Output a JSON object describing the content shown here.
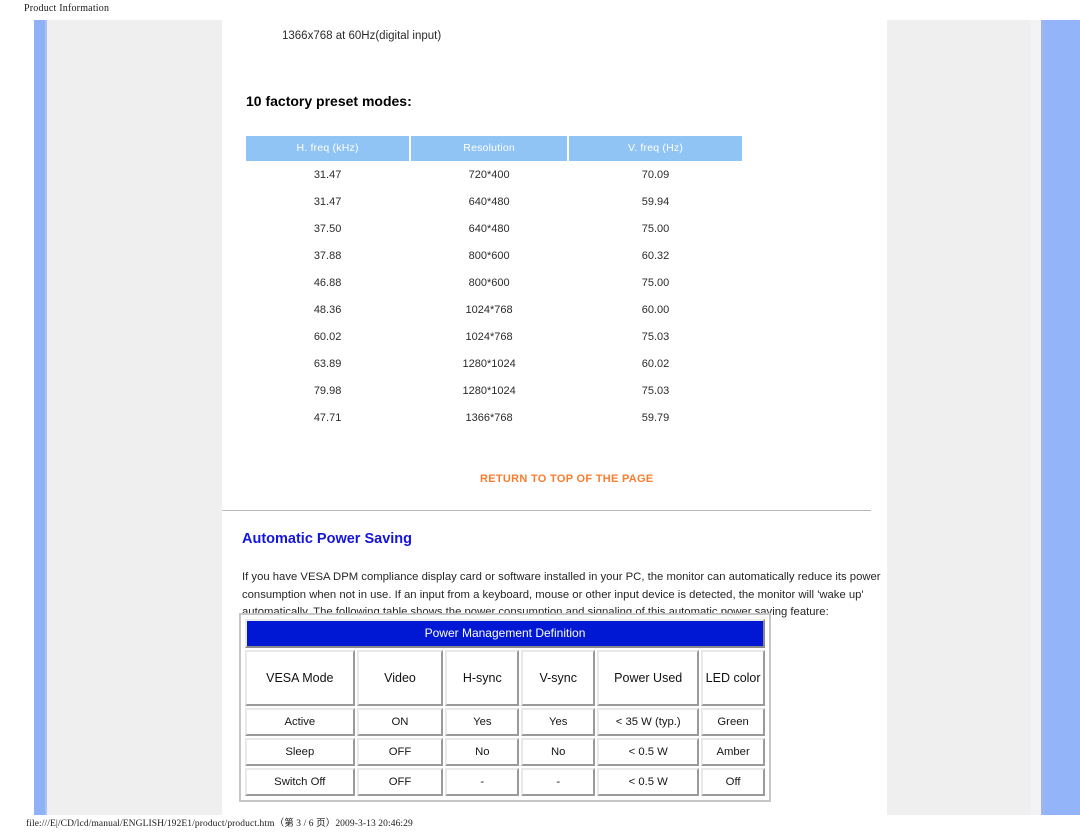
{
  "print": {
    "header_title": "Product Information",
    "footer_text": "file:///E|/CD/lcd/manual/ENGLISH/192E1/product/product.htm（第 3 / 6 页）2009-3-13 20:46:29"
  },
  "page": {
    "resolution_note": "1366x768 at 60Hz(digital input)",
    "preset_section_title": "10 factory preset modes:",
    "return_link": "RETURN TO TOP OF THE PAGE",
    "power_heading": "Automatic Power Saving",
    "power_paragraph": "If you have VESA DPM compliance display card or software installed in your PC, the monitor can automatically reduce its power consumption when not in use. If an input from a keyboard, mouse or other input device is detected, the monitor will 'wake up' automatically. The following table shows the power consumption and signaling of this automatic power saving feature:"
  },
  "preset_table": {
    "headers": [
      "H. freq (kHz)",
      "Resolution",
      "V. freq (Hz)"
    ],
    "rows": [
      [
        "31.47",
        "720*400",
        "70.09"
      ],
      [
        "31.47",
        "640*480",
        "59.94"
      ],
      [
        "37.50",
        "640*480",
        "75.00"
      ],
      [
        "37.88",
        "800*600",
        "60.32"
      ],
      [
        "46.88",
        "800*600",
        "75.00"
      ],
      [
        "48.36",
        "1024*768",
        "60.00"
      ],
      [
        "60.02",
        "1024*768",
        "75.03"
      ],
      [
        "63.89",
        "1280*1024",
        "60.02"
      ],
      [
        "79.98",
        "1280*1024",
        "75.03"
      ],
      [
        "47.71",
        "1366*768",
        "59.79"
      ]
    ]
  },
  "power_table": {
    "title": "Power Management Definition",
    "headers": [
      "VESA Mode",
      "Video",
      "H-sync",
      "V-sync",
      "Power Used",
      "LED color"
    ],
    "rows": [
      [
        "Active",
        "ON",
        "Yes",
        "Yes",
        "< 35 W (typ.)",
        "Green"
      ],
      [
        "Sleep",
        "OFF",
        "No",
        "No",
        "< 0.5 W",
        "Amber"
      ],
      [
        "Switch Off",
        "OFF",
        "-",
        "-",
        "< 0.5 W",
        "Off"
      ]
    ]
  },
  "colors": {
    "preset_header_bg": "#8fc4f5",
    "power_title_bg": "#0018d4",
    "link_orange": "#f97d2f",
    "heading_blue": "#1414e0",
    "side_bar_blue": "#93b4f8",
    "side_panel_gray": "#efefef"
  }
}
